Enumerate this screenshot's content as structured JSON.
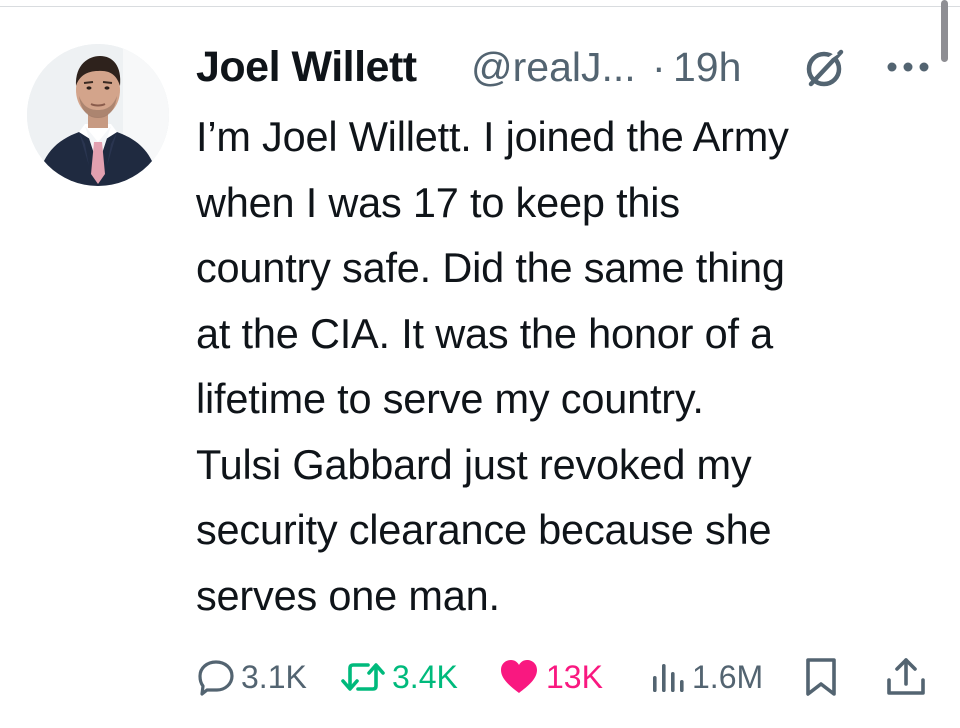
{
  "author": {
    "name": "Joel Willett",
    "handle": "@realJ...",
    "separator": "·",
    "time": "19h"
  },
  "icons": {
    "avatar": "profile-photo",
    "grok": "grok-icon",
    "more": "more-options-icon"
  },
  "tweet": {
    "text": "I’m Joel Willett. I joined the Army\nwhen I was 17 to keep this\ncountry safe. Did the same thing\nat the CIA. It was the honor of a\nlifetime to serve my country.\nTulsi Gabbard just revoked my\nsecurity clearance because she\nserves one man."
  },
  "actions": {
    "reply": {
      "count": "3.1K",
      "icon": "reply-icon",
      "color": "#536471"
    },
    "retweet": {
      "count": "3.4K",
      "icon": "retweet-icon",
      "color": "#00ba7c"
    },
    "like": {
      "count": "13K",
      "icon": "heart-icon",
      "color": "#f91880",
      "liked": true
    },
    "views": {
      "count": "1.6M",
      "icon": "views-icon",
      "color": "#536471"
    },
    "bookmark": {
      "icon": "bookmark-icon"
    },
    "share": {
      "icon": "share-icon"
    }
  }
}
